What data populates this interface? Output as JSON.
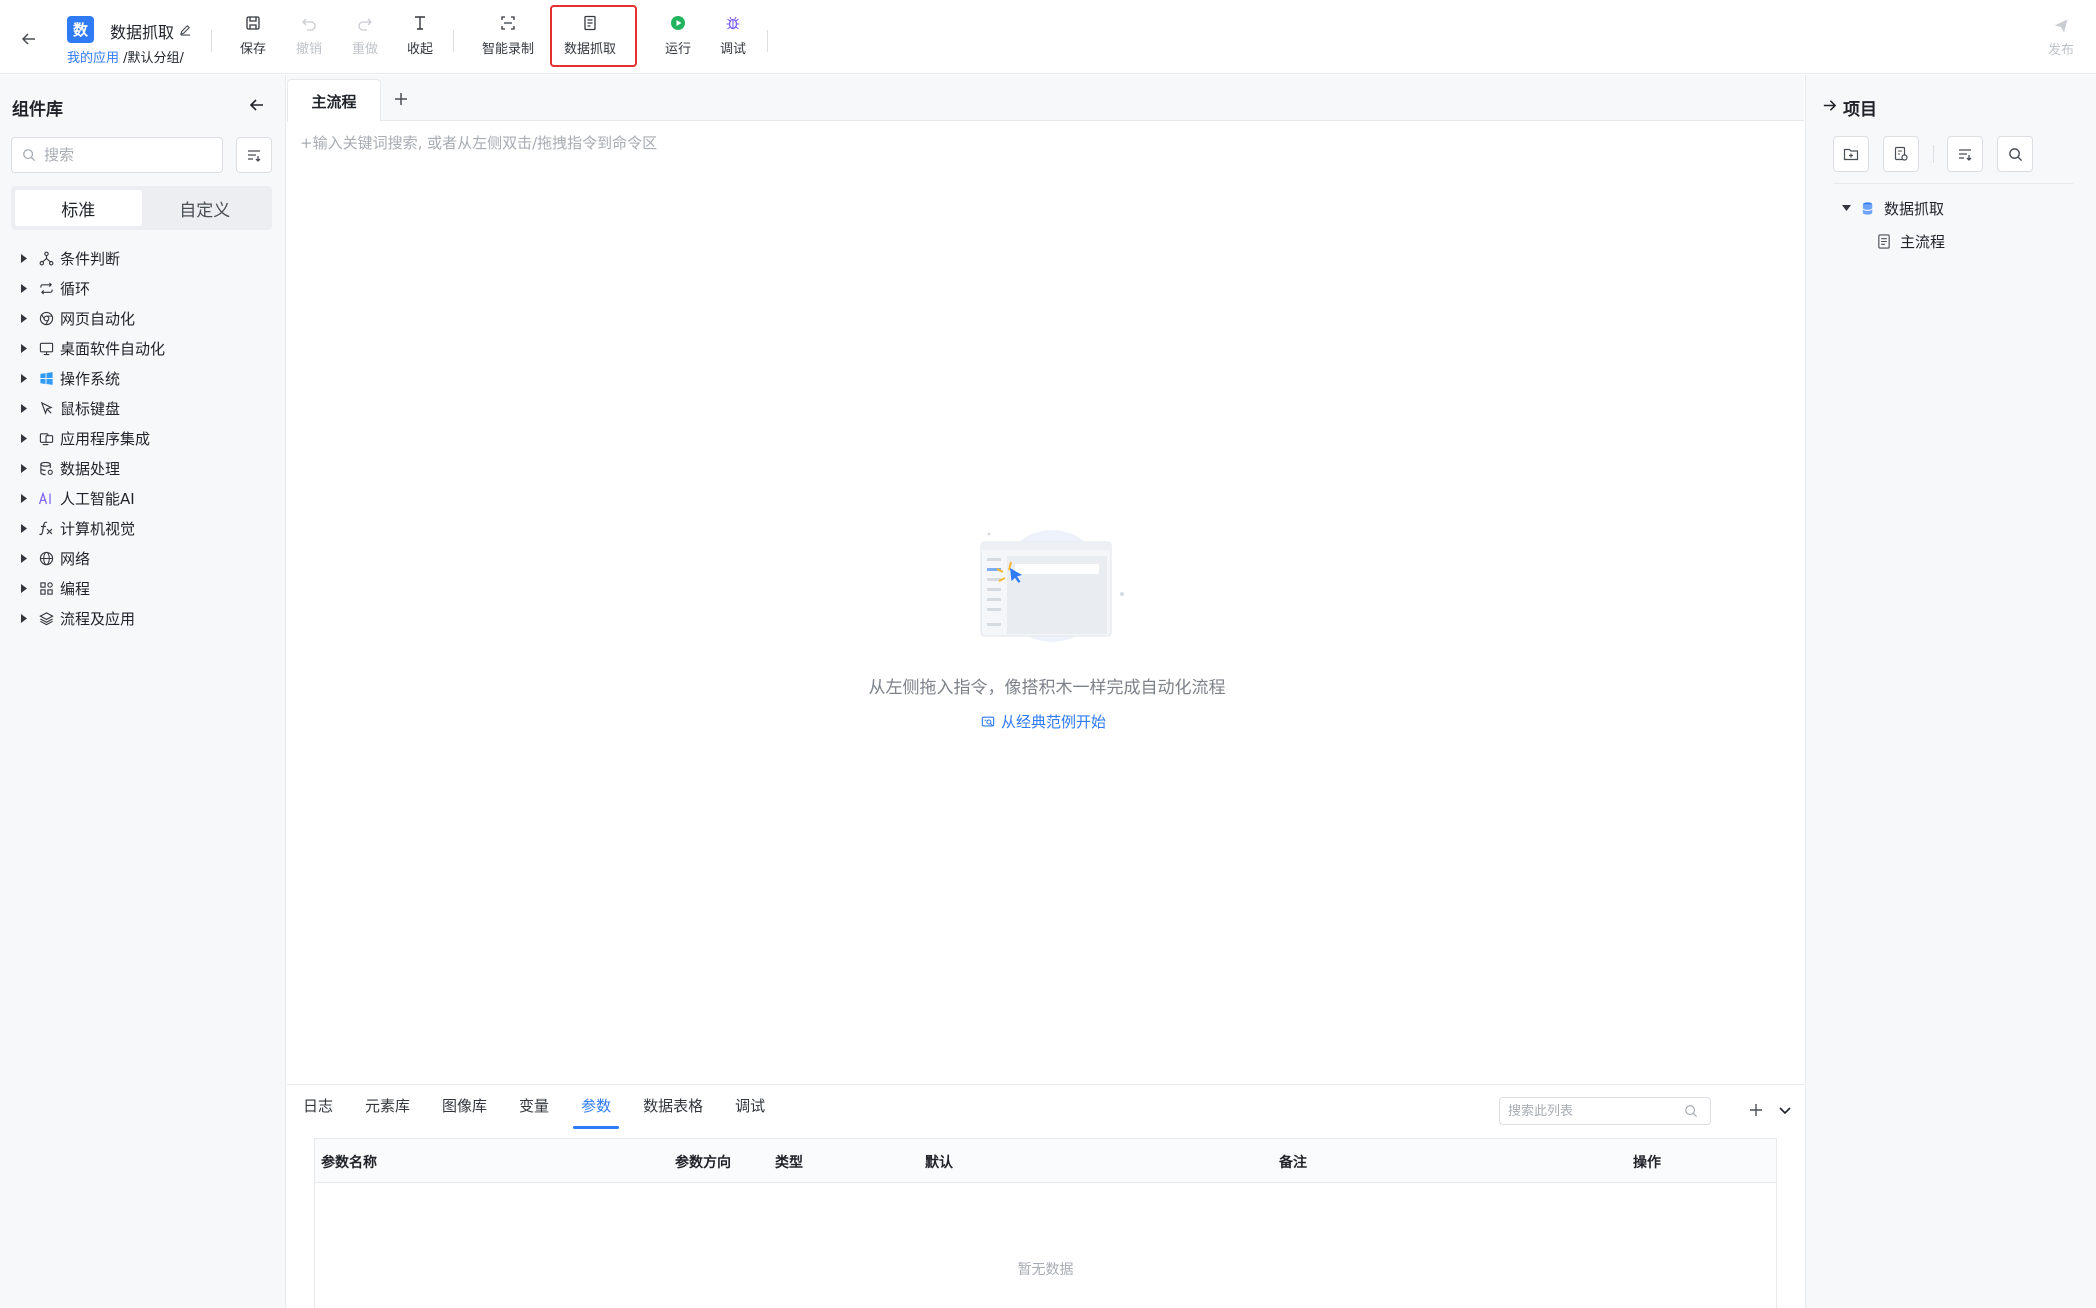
{
  "header": {
    "app_badge": "数",
    "app_title": "数据抓取",
    "breadcrumb_app": "我的应用",
    "breadcrumb_group": " /默认分组/",
    "toolbar": {
      "save": "保存",
      "undo": "撤销",
      "redo": "重做",
      "collapse": "收起",
      "smart_record": "智能录制",
      "data_capture": "数据抓取",
      "run": "运行",
      "debug": "调试",
      "publish": "发布"
    }
  },
  "library": {
    "title": "组件库",
    "search_placeholder": "搜索",
    "tabs": [
      "标准",
      "自定义"
    ],
    "active_tab": "标准",
    "items": [
      {
        "label": "条件判断",
        "icon": "branch-icon"
      },
      {
        "label": "循环",
        "icon": "loop-icon"
      },
      {
        "label": "网页自动化",
        "icon": "browser-icon"
      },
      {
        "label": "桌面软件自动化",
        "icon": "monitor-icon"
      },
      {
        "label": "操作系统",
        "icon": "windows-icon"
      },
      {
        "label": "鼠标键盘",
        "icon": "cursor-icon"
      },
      {
        "label": "应用程序集成",
        "icon": "app-integration-icon"
      },
      {
        "label": "数据处理",
        "icon": "database-icon"
      },
      {
        "label": "人工智能AI",
        "icon": "ai-icon"
      },
      {
        "label": "计算机视觉",
        "icon": "function-icon"
      },
      {
        "label": "网络",
        "icon": "globe-icon"
      },
      {
        "label": "编程",
        "icon": "code-blocks-icon"
      },
      {
        "label": "流程及应用",
        "icon": "layers-icon"
      }
    ]
  },
  "editor": {
    "tab_main": "主流程",
    "command_placeholder": "+输入关键词搜索, 或者从左侧双击/拖拽指令到命令区",
    "empty_text": "从左侧拖入指令，像搭积木一样完成自动化流程",
    "example_link": "从经典范例开始"
  },
  "bottom": {
    "tabs": [
      "日志",
      "元素库",
      "图像库",
      "变量",
      "参数",
      "数据表格",
      "调试"
    ],
    "active_tab": "参数",
    "search_placeholder": "搜索此列表",
    "columns": [
      "参数名称",
      "参数方向",
      "类型",
      "默认",
      "备注",
      "操作"
    ],
    "empty": "暂无数据"
  },
  "project": {
    "title": "项目",
    "root": "数据抓取",
    "child": "主流程"
  },
  "colors": {
    "accent": "#2f7bf5",
    "highlight": "#e52e2e",
    "run": "#22b35e",
    "debug": "#7b5cf5"
  }
}
